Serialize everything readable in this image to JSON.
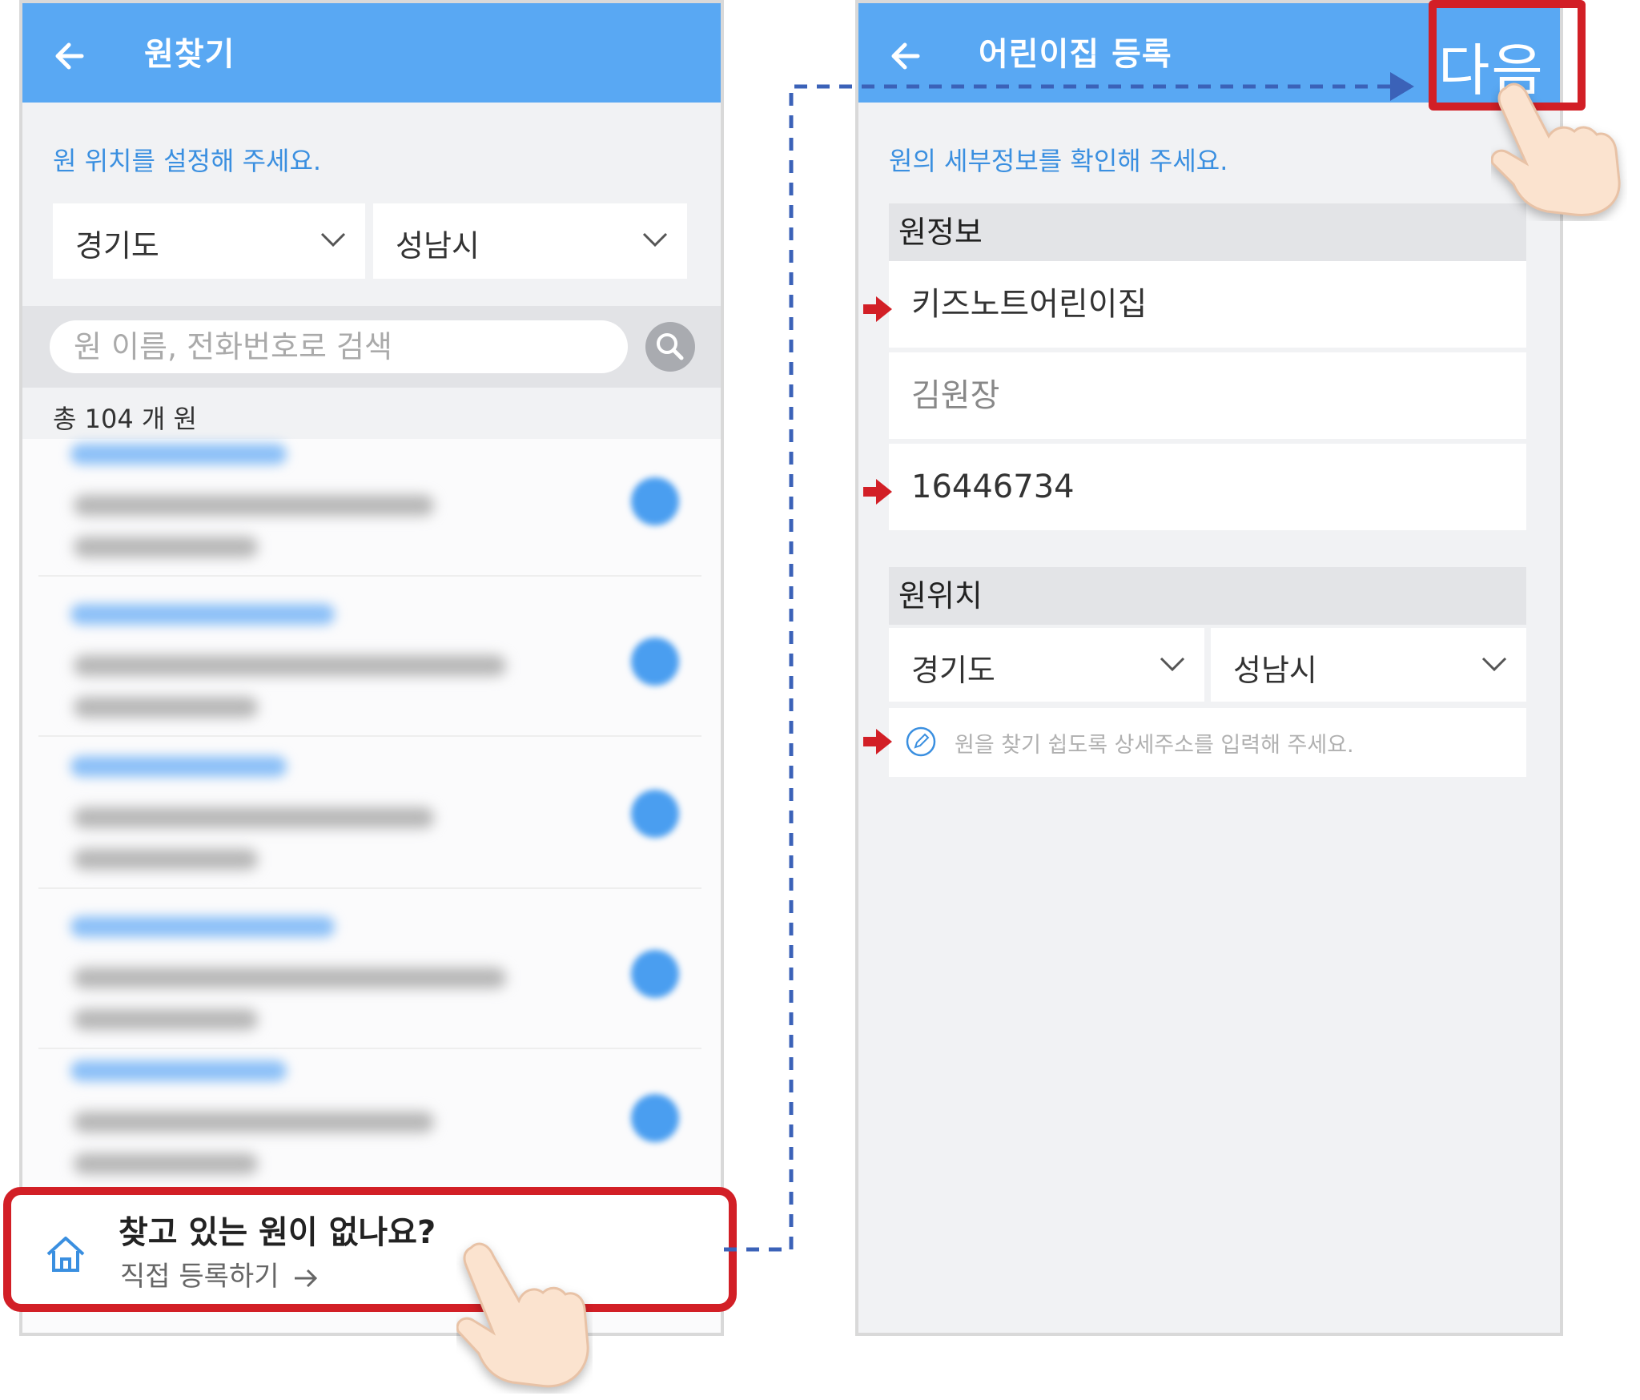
{
  "left_screen": {
    "appbar": {
      "title": "원찾기",
      "back_icon": "arrow-left-icon"
    },
    "hint": "원 위치를 설정해 주세요.",
    "province_select": {
      "value": "경기도"
    },
    "city_select": {
      "value": "성남시"
    },
    "search": {
      "placeholder": "원 이름, 전화번호로 검색",
      "icon": "search-icon"
    },
    "count_label": "총 104 개 원",
    "results_note": "blurred result list",
    "cta": {
      "title": "찾고 있는 원이 없나요?",
      "subtitle": "직접 등록하기",
      "icon": "home-icon"
    }
  },
  "right_screen": {
    "appbar": {
      "title": "어린이집 등록",
      "back_icon": "arrow-left-icon",
      "next_label": "다음"
    },
    "hint": "원의 세부정보를 확인해 주세요.",
    "info_section": {
      "header": "원정보",
      "name": "키즈노트어린이집",
      "director": "김원장",
      "phone": "16446734"
    },
    "location_section": {
      "header": "원위치",
      "province": "경기도",
      "city": "성남시",
      "address_placeholder": "원을 찾기 쉽도록 상세주소를 입력해 주세요.",
      "address_icon": "pencil-icon"
    }
  },
  "colors": {
    "appbar": "#59a8f3",
    "highlight": "#d21f26",
    "hint_text": "#3a8fe0",
    "connector": "#3b62b8"
  }
}
